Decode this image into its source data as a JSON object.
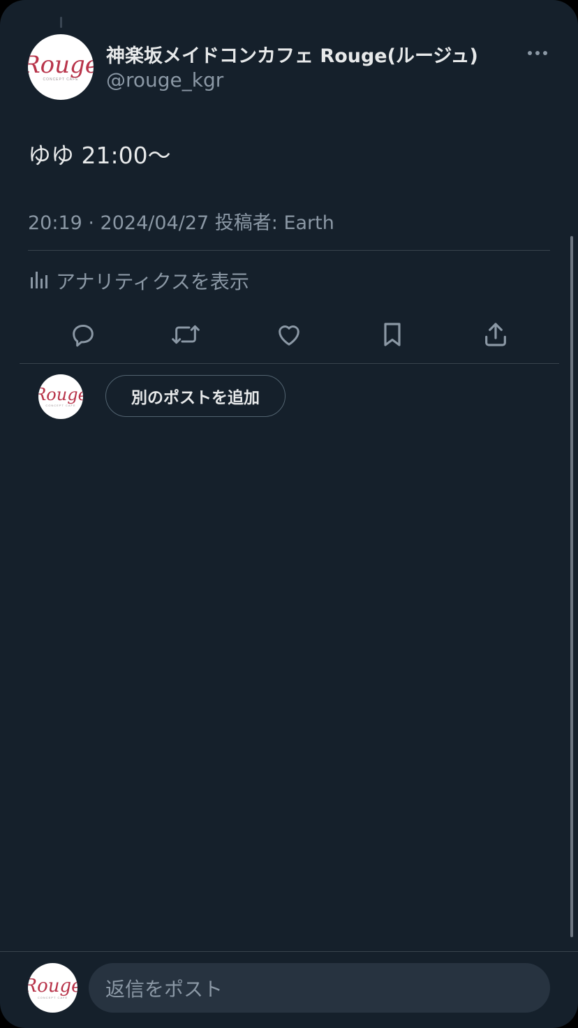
{
  "post": {
    "author": {
      "display_name": "神楽坂メイドコンカフェ Rouge(ルージュ)",
      "handle": "@rouge_kgr",
      "avatar_logo": "Rouge"
    },
    "text": "ゆゆ 21:00〜",
    "meta": "20:19 · 2024/04/27 投稿者: Earth",
    "analytics_label": "アナリティクスを表示"
  },
  "actions": [
    {
      "name": "reply-icon"
    },
    {
      "name": "repost-icon"
    },
    {
      "name": "like-icon"
    },
    {
      "name": "bookmark-icon"
    },
    {
      "name": "share-icon"
    }
  ],
  "thread": {
    "add_post_label": "別のポストを追加",
    "avatar_logo": "Rouge"
  },
  "composer": {
    "placeholder": "返信をポスト",
    "avatar_logo": "Rouge"
  },
  "colors": {
    "background": "#15202b",
    "text_primary": "#e7e9ea",
    "text_secondary": "#8b98a5",
    "border": "#38444d",
    "input_bg": "#273340",
    "brand": "#b8344a"
  }
}
